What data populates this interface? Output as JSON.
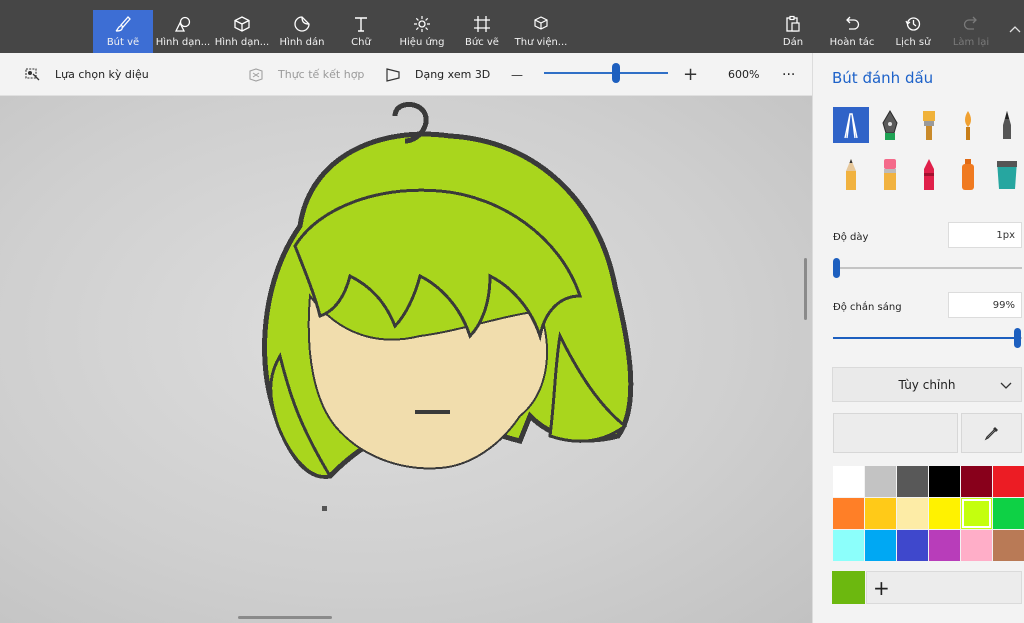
{
  "toolbar": {
    "tools": [
      {
        "label": "Bút vẽ",
        "icon": "brush-icon",
        "active": true
      },
      {
        "label": "Hình dạn...",
        "icon": "2d-shapes-icon"
      },
      {
        "label": "Hình dạn...",
        "icon": "3d-shapes-icon"
      },
      {
        "label": "Hình dán",
        "icon": "stickers-icon"
      },
      {
        "label": "Chữ",
        "icon": "text-icon"
      },
      {
        "label": "Hiệu ứng",
        "icon": "effects-icon"
      },
      {
        "label": "Bức vẽ",
        "icon": "canvas-icon"
      },
      {
        "label": "Thư viện...",
        "icon": "3d-library-icon"
      }
    ],
    "right": [
      {
        "label": "Dán",
        "icon": "paste-icon"
      },
      {
        "label": "Hoàn tác",
        "icon": "undo-icon"
      },
      {
        "label": "Lịch sử",
        "icon": "history-icon"
      },
      {
        "label": "Làm lại",
        "icon": "redo-icon",
        "disabled": true
      }
    ]
  },
  "subbar": {
    "magic_select": "Lựa chọn kỳ diệu",
    "mixed_reality": "Thực tế kết hợp",
    "view_3d": "Dạng xem 3D",
    "zoom_minus": "—",
    "zoom_plus": "+",
    "zoom_value": "600%",
    "more": "···",
    "zoom_level": 0.58
  },
  "panel": {
    "title": "Bút đánh dấu",
    "brushes": [
      "marker-brush-icon",
      "calligraphy-pen-icon",
      "oil-brush-icon",
      "watercolor-icon",
      "pixel-pen-icon",
      "pencil-icon",
      "eraser-icon",
      "crayon-icon",
      "spray-can-icon",
      "fill-bucket-icon"
    ],
    "thickness_label": "Độ dày",
    "thickness_value": "1px",
    "thickness_level": 0.0,
    "opacity_label": "Độ chắn sáng",
    "opacity_value": "99%",
    "opacity_level": 0.99,
    "dropdown_value": "Tùy chỉnh",
    "palette": [
      "#ffffff",
      "#c3c3c3",
      "#585858",
      "#000000",
      "#88001b",
      "#ec1c24",
      "#ff7f27",
      "#ffca18",
      "#fdeca6",
      "#fff200",
      "#c4ff0e",
      "#0ed145",
      "#8cfffb",
      "#00a8f3",
      "#3f48cc",
      "#b83dba",
      "#ffaec8",
      "#b97a56"
    ],
    "selected_palette_index": 10,
    "current_color": "#6cb80f",
    "add_label": "+"
  },
  "colors": {
    "accent": "#3d6ed4",
    "hair": "#a9d61d",
    "skin": "#f1ddad",
    "outline": "#3a3a3a"
  }
}
